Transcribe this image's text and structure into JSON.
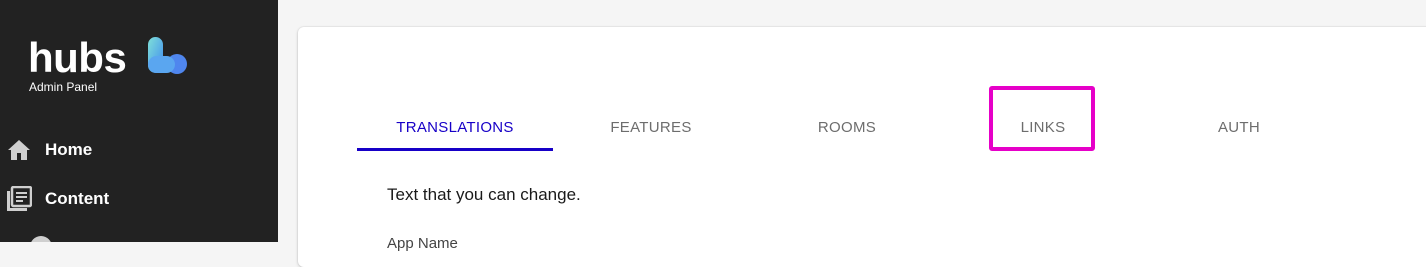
{
  "brand": {
    "name": "hubs",
    "subtitle": "Admin Panel",
    "mark_colors": [
      "#7fe0d8",
      "#3f8cf0"
    ]
  },
  "sidebar": {
    "items": [
      {
        "label": "Home",
        "icon": "home-icon"
      },
      {
        "label": "Content",
        "icon": "library-icon"
      }
    ]
  },
  "tabs": {
    "items": [
      "TRANSLATIONS",
      "FEATURES",
      "ROOMS",
      "LINKS",
      "AUTH"
    ],
    "active_index": 0,
    "active_color": "#1700c7",
    "highlighted": "LINKS",
    "highlight_color": "#e600c8"
  },
  "content": {
    "description": "Text that you can change.",
    "next_field_label": "App Name"
  }
}
